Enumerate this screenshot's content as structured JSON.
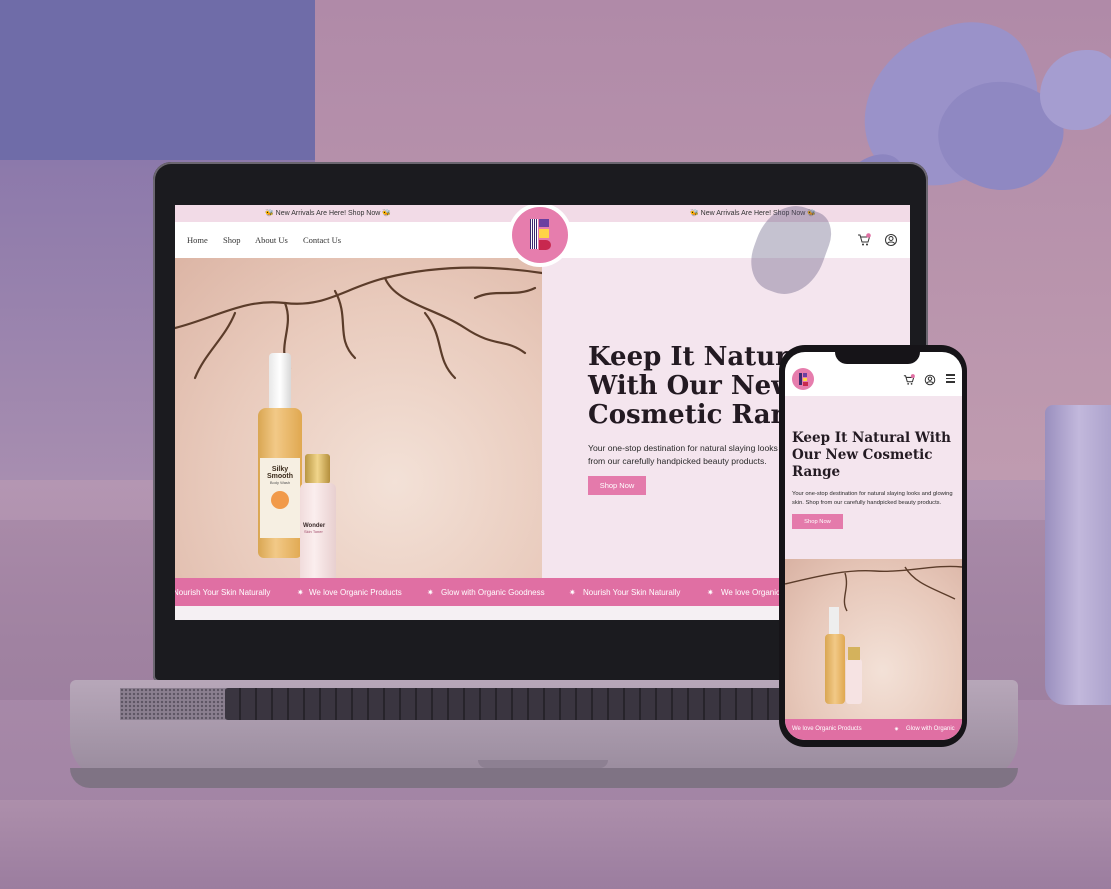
{
  "topbar": {
    "announcement_left": "🐝 New Arrivals Are Here! Shop Now 🐝",
    "announcement_right": "🐝 New Arrivals Are Here! Shop Now 🐝"
  },
  "nav": {
    "items": [
      "Home",
      "Shop",
      "About Us",
      "Contact Us"
    ],
    "cart_count": "0"
  },
  "hero": {
    "title": "Keep It Natural With Our New Cosmetic Range",
    "text": "Your one-stop destination for natural slaying looks and glowing skin. Shop from our carefully handpicked beauty products.",
    "button": "Shop Now"
  },
  "product_labels": {
    "bottle1_name": "Silky Smooth",
    "bottle1_sub": "Body Wash",
    "bottle2_name": "Wonder",
    "bottle2_sub": "Skin Toner"
  },
  "marquee": {
    "items": [
      "Nourish Your Skin Naturally",
      "We love Organic Products",
      "Glow with Organic Goodness",
      "Nourish Your Skin Naturally",
      "We love Organic Products"
    ]
  },
  "mobile": {
    "title": "Keep It Natural With Our New Cosmetic Range",
    "text": "Your one-stop destination for natural slaying looks and glowing skin. Shop from our carefully handpicked beauty products.",
    "button": "Shop Now",
    "cart_count": "0",
    "marquee": [
      "We love Organic Products",
      "Glow with Organic"
    ]
  },
  "colors": {
    "brand_pink": "#e06fa3",
    "hero_bg": "#f4e5ee",
    "topbar_bg": "#f2dbe7"
  }
}
